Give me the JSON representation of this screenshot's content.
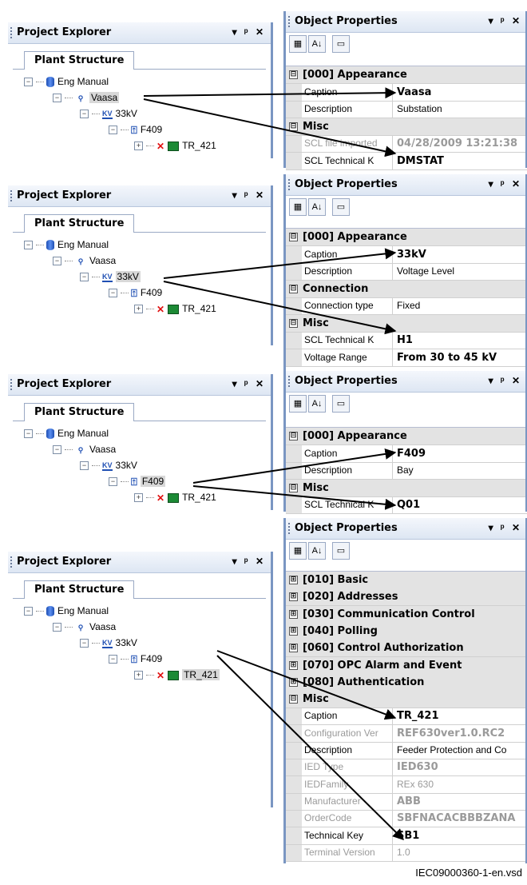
{
  "panels": [
    {
      "pe_title": "Project Explorer",
      "pe_tab": "Plant Structure",
      "pe_icons": "▾ ᵖ ✕",
      "tree": [
        "Eng Manual",
        "Vaasa",
        "33kV",
        "F409",
        "TR_421"
      ],
      "op_title": "Object Properties",
      "op_icons": "▾ ᵖ ✕",
      "rows": [
        {
          "t": "cat",
          "sign": "⊟",
          "label": "[000] Appearance"
        },
        {
          "t": "prop",
          "name": "Caption",
          "value": "Vaasa",
          "bold": true
        },
        {
          "t": "prop",
          "name": "Description",
          "value": "Substation"
        },
        {
          "t": "cat",
          "sign": "⊟",
          "label": "Misc"
        },
        {
          "t": "prop",
          "name": "SCL file imported",
          "value": "04/28/2009 13:21:38",
          "dim": true,
          "bold": true
        },
        {
          "t": "prop",
          "name": "SCL Technical K",
          "value": "DMSTAT",
          "bold": true
        }
      ]
    },
    {
      "pe_title": "Project Explorer",
      "pe_tab": "Plant Structure",
      "pe_icons": "▾ ᵖ ✕",
      "tree": [
        "Eng Manual",
        "Vaasa",
        "33kV",
        "F409",
        "TR_421"
      ],
      "op_title": "Object Properties",
      "op_icons": "▾ ᵖ ✕",
      "rows": [
        {
          "t": "cat",
          "sign": "⊟",
          "label": "[000] Appearance"
        },
        {
          "t": "prop",
          "name": "Caption",
          "value": "33kV",
          "bold": true
        },
        {
          "t": "prop",
          "name": "Description",
          "value": "Voltage Level"
        },
        {
          "t": "cat",
          "sign": "⊟",
          "label": "Connection"
        },
        {
          "t": "prop",
          "name": "Connection type",
          "value": "Fixed"
        },
        {
          "t": "cat",
          "sign": "⊟",
          "label": "Misc"
        },
        {
          "t": "prop",
          "name": "SCL Technical K",
          "value": "H1",
          "bold": true
        },
        {
          "t": "prop",
          "name": "Voltage Range",
          "value": "From 30 to 45 kV",
          "bold": true
        }
      ]
    },
    {
      "pe_title": "Project Explorer",
      "pe_tab": "Plant Structure",
      "pe_icons": "▾ ᵖ ✕",
      "tree": [
        "Eng Manual",
        "Vaasa",
        "33kV",
        "F409",
        "TR_421"
      ],
      "op_title": "Object Properties",
      "op_icons": "▾ ᵖ ✕",
      "rows": [
        {
          "t": "cat",
          "sign": "⊟",
          "label": "[000] Appearance"
        },
        {
          "t": "prop",
          "name": "Caption",
          "value": "F409",
          "bold": true
        },
        {
          "t": "prop",
          "name": "Description",
          "value": "Bay"
        },
        {
          "t": "cat",
          "sign": "⊟",
          "label": "Misc"
        },
        {
          "t": "prop",
          "name": "SCL Technical K",
          "value": "Q01",
          "bold": true
        }
      ]
    },
    {
      "pe_title": "Project Explorer",
      "pe_tab": "Plant Structure",
      "pe_icons": "▾ ᵖ ✕",
      "tree": [
        "Eng Manual",
        "Vaasa",
        "33kV",
        "F409",
        "TR_421"
      ],
      "op_title": "Object Properties",
      "op_icons": "▾ ᵖ ✕",
      "rows": [
        {
          "t": "cat",
          "sign": "⊞",
          "label": "[010] Basic"
        },
        {
          "t": "cat",
          "sign": "⊞",
          "label": "[020] Addresses"
        },
        {
          "t": "cat",
          "sign": "⊞",
          "label": "[030] Communication Control"
        },
        {
          "t": "cat",
          "sign": "⊞",
          "label": "[040] Polling"
        },
        {
          "t": "cat",
          "sign": "⊞",
          "label": "[060] Control Authorization"
        },
        {
          "t": "cat",
          "sign": "⊞",
          "label": "[070] OPC Alarm and Event"
        },
        {
          "t": "cat",
          "sign": "⊞",
          "label": "[080] Authentication"
        },
        {
          "t": "cat",
          "sign": "⊟",
          "label": "Misc"
        },
        {
          "t": "prop",
          "name": "Caption",
          "value": "TR_421",
          "bold": true
        },
        {
          "t": "prop",
          "name": "Configuration Ver",
          "value": "REF630ver1.0.RC2",
          "dim": true,
          "bold": true
        },
        {
          "t": "prop",
          "name": "Description",
          "value": "Feeder Protection and Co"
        },
        {
          "t": "prop",
          "name": "IED Type",
          "value": "IED630",
          "dim": true,
          "bold": true
        },
        {
          "t": "prop",
          "name": "IEDFamily",
          "value": "REx 630",
          "dim": true
        },
        {
          "t": "prop",
          "name": "Manufacturer",
          "value": "ABB",
          "dim": true,
          "bold": true
        },
        {
          "t": "prop",
          "name": "OrderCode",
          "value": "SBFNACACBBBZANA",
          "dim": true,
          "bold": true
        },
        {
          "t": "prop",
          "name": "Technical Key",
          "value": "SB1",
          "bold": true
        },
        {
          "t": "prop",
          "name": "Terminal Version",
          "value": "1.0",
          "dim": true
        }
      ]
    }
  ],
  "caption": "IEC09000360-1-en.vsd"
}
